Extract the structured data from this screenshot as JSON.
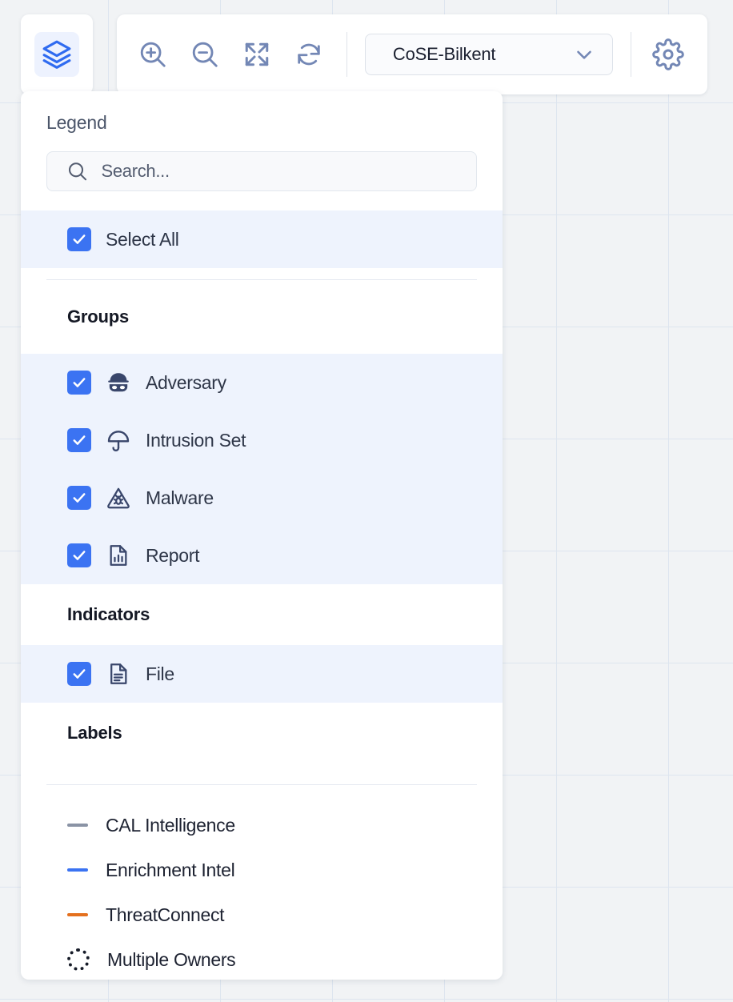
{
  "toolbar": {
    "layers_button": {
      "label": "Layers",
      "icon": "layers-icon",
      "accent": "#2f6bf0",
      "chip_bg": "#edf2fe"
    },
    "zoom_in": {
      "label": "Zoom In",
      "icon": "zoom-in-icon"
    },
    "zoom_out": {
      "label": "Zoom Out",
      "icon": "zoom-out-icon"
    },
    "fit": {
      "label": "Fit to Screen",
      "icon": "expand-arrows-icon"
    },
    "refresh": {
      "label": "Refresh Layout",
      "icon": "refresh-icon"
    },
    "layout_select": {
      "value": "CoSE-Bilkent",
      "icon": "chevron-down-icon",
      "options": [
        "CoSE-Bilkent"
      ]
    },
    "settings": {
      "label": "Settings",
      "icon": "gear-icon"
    },
    "icon_color": "#7387b5"
  },
  "legend": {
    "title": "Legend",
    "search": {
      "value": "",
      "placeholder": "Search..."
    },
    "select_all": {
      "label": "Select All",
      "checked": true
    },
    "sections": [
      {
        "heading": "Groups",
        "items": [
          {
            "label": "Adversary",
            "icon": "adversary-mask-icon",
            "checked": true
          },
          {
            "label": "Intrusion Set",
            "icon": "umbrella-icon",
            "checked": true
          },
          {
            "label": "Malware",
            "icon": "malware-bug-triangle-icon",
            "checked": true
          },
          {
            "label": "Report",
            "icon": "report-document-chart-icon",
            "checked": true
          }
        ]
      },
      {
        "heading": "Indicators",
        "items": [
          {
            "label": "File",
            "icon": "file-document-icon",
            "checked": true
          }
        ]
      }
    ],
    "labels": {
      "heading": "Labels",
      "items": [
        {
          "label": "CAL Intelligence",
          "swatch": "line",
          "color": "#8a93a5"
        },
        {
          "label": "Enrichment Intel",
          "swatch": "line",
          "color": "#3b73f2"
        },
        {
          "label": "ThreatConnect",
          "swatch": "line",
          "color": "#e4701e"
        },
        {
          "label": "Multiple Owners",
          "swatch": "dotted-circle",
          "color": "#161b28"
        }
      ]
    },
    "colors": {
      "checkbox": "#3b73f2",
      "row_selected_bg": "#eef3fd",
      "icon": "#39466b"
    }
  },
  "canvas": {
    "background": "#f1f3f5",
    "grid_color": "#dde5ef",
    "grid_size": 140
  }
}
